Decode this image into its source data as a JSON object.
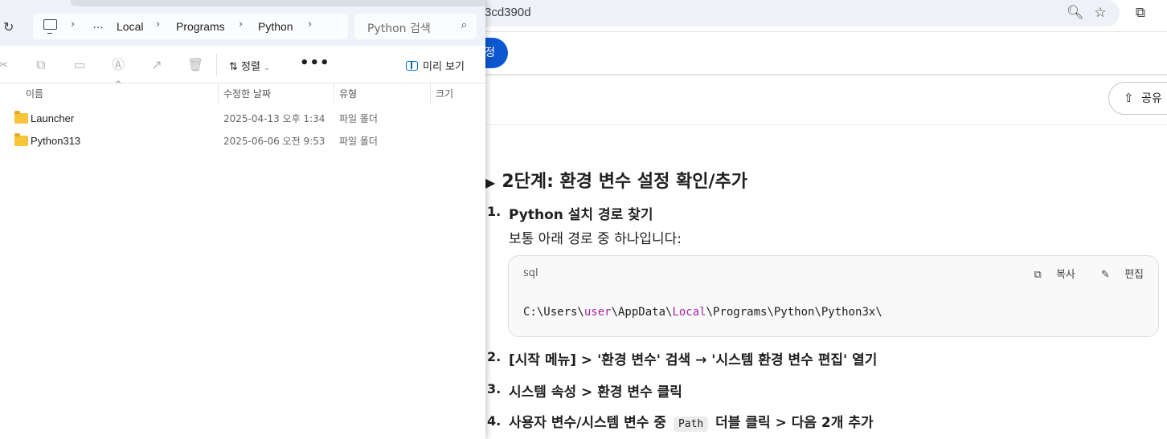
{
  "browser": {
    "address_fragment": "3cd390d",
    "zoom_icon": "zoom-icon",
    "star_icon": "star-icon",
    "extensions_icon": "extensions-icon",
    "blue_button_label": "정",
    "share_label": "공유"
  },
  "doc": {
    "heading": "2단계: 환경 변수 설정 확인/추가",
    "heading_marker": "▶",
    "steps": [
      {
        "num": "1.",
        "title": "Python 설치 경로 찾기",
        "sub": "보통 아래 경로 중 하나입니다:"
      },
      {
        "num": "2.",
        "title": "[시작 메뉴] > '환경 변수' 검색 → '시스템 환경 변수 편집' 열기"
      },
      {
        "num": "3.",
        "title": "시스템 속성 > 환경 변수 클릭"
      },
      {
        "num": "4.",
        "title_before": "사용자 변수/시스템 변수 중",
        "code": "Path",
        "title_after": "더블 클릭 > 다음 2개 추가"
      }
    ],
    "code_block": {
      "lang": "sql",
      "copy_label": "복사",
      "edit_label": "편집",
      "line_parts": [
        "C:\\Users\\",
        "user",
        "\\AppData\\",
        "Local",
        "\\Programs\\Python\\Python3x\\"
      ]
    }
  },
  "explorer": {
    "breadcrumb": [
      "…",
      "Local",
      "Programs",
      "Python"
    ],
    "search_placeholder": "Python 검색",
    "toolbar": {
      "sort_label": "정렬",
      "more_label": "•••",
      "preview_label": "미리 보기"
    },
    "columns": [
      "이름",
      "수정한 날짜",
      "유형",
      "크기"
    ],
    "rows": [
      {
        "name": "Launcher",
        "date": "2025-04-13 오후 1:34",
        "type": "파일 폴더"
      },
      {
        "name": "Python313",
        "date": "2025-06-06 오전 9:53",
        "type": "파일 폴더"
      }
    ]
  }
}
